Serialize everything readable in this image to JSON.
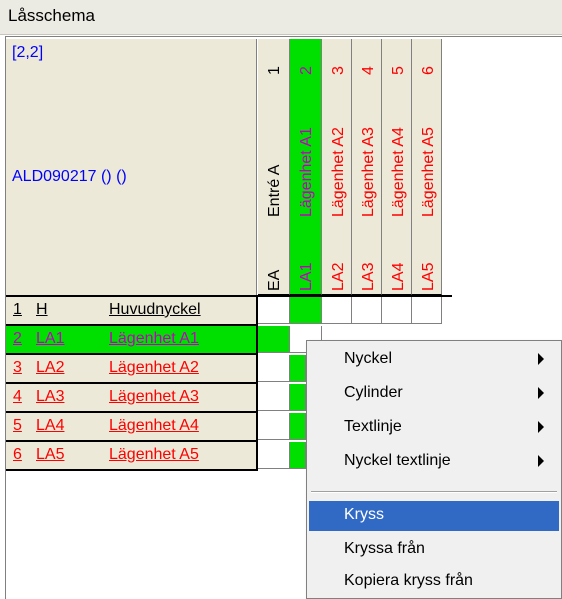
{
  "window": {
    "title": "Låsschema"
  },
  "info": {
    "coords": "[2,2]",
    "id": "ALD090217 () ()"
  },
  "columns": [
    {
      "num": "1",
      "name": "Entré A",
      "code": "EA",
      "selected": false
    },
    {
      "num": "2",
      "name": "Lägenhet A1",
      "code": "LA1",
      "selected": true
    },
    {
      "num": "3",
      "name": "Lägenhet A2",
      "code": "LA2",
      "selected": false
    },
    {
      "num": "4",
      "name": "Lägenhet A3",
      "code": "LA3",
      "selected": false
    },
    {
      "num": "5",
      "name": "Lägenhet A4",
      "code": "LA4",
      "selected": false
    },
    {
      "num": "6",
      "name": "Lägenhet A5",
      "code": "LA5",
      "selected": false
    }
  ],
  "rows": [
    {
      "num": "1",
      "code": "H",
      "name": "Huvudnyckel"
    },
    {
      "num": "2",
      "code": "LA1",
      "name": "Lägenhet A1"
    },
    {
      "num": "3",
      "code": "LA2",
      "name": "Lägenhet A2"
    },
    {
      "num": "4",
      "code": "LA3",
      "name": "Lägenhet A3"
    },
    {
      "num": "5",
      "code": "LA4",
      "name": "Lägenhet A4"
    },
    {
      "num": "6",
      "code": "LA5",
      "name": "Lägenhet A5"
    }
  ],
  "context_menu": {
    "items": [
      {
        "label": "Nyckel",
        "submenu": true
      },
      {
        "label": "Cylinder",
        "submenu": true
      },
      {
        "label": "Textlinje",
        "submenu": true
      },
      {
        "label": "Nyckel textlinje",
        "submenu": true
      },
      {
        "label": "Kryss",
        "highlighted": true
      },
      {
        "label": "Kryssa från"
      },
      {
        "label": "Kopiera kryss från"
      }
    ]
  },
  "colors": {
    "selected_green": "#00e000",
    "highlight_blue": "#316ac5",
    "text_blue": "#0000ff",
    "text_red": "#ff0000",
    "text_magenta": "#c000c0"
  }
}
